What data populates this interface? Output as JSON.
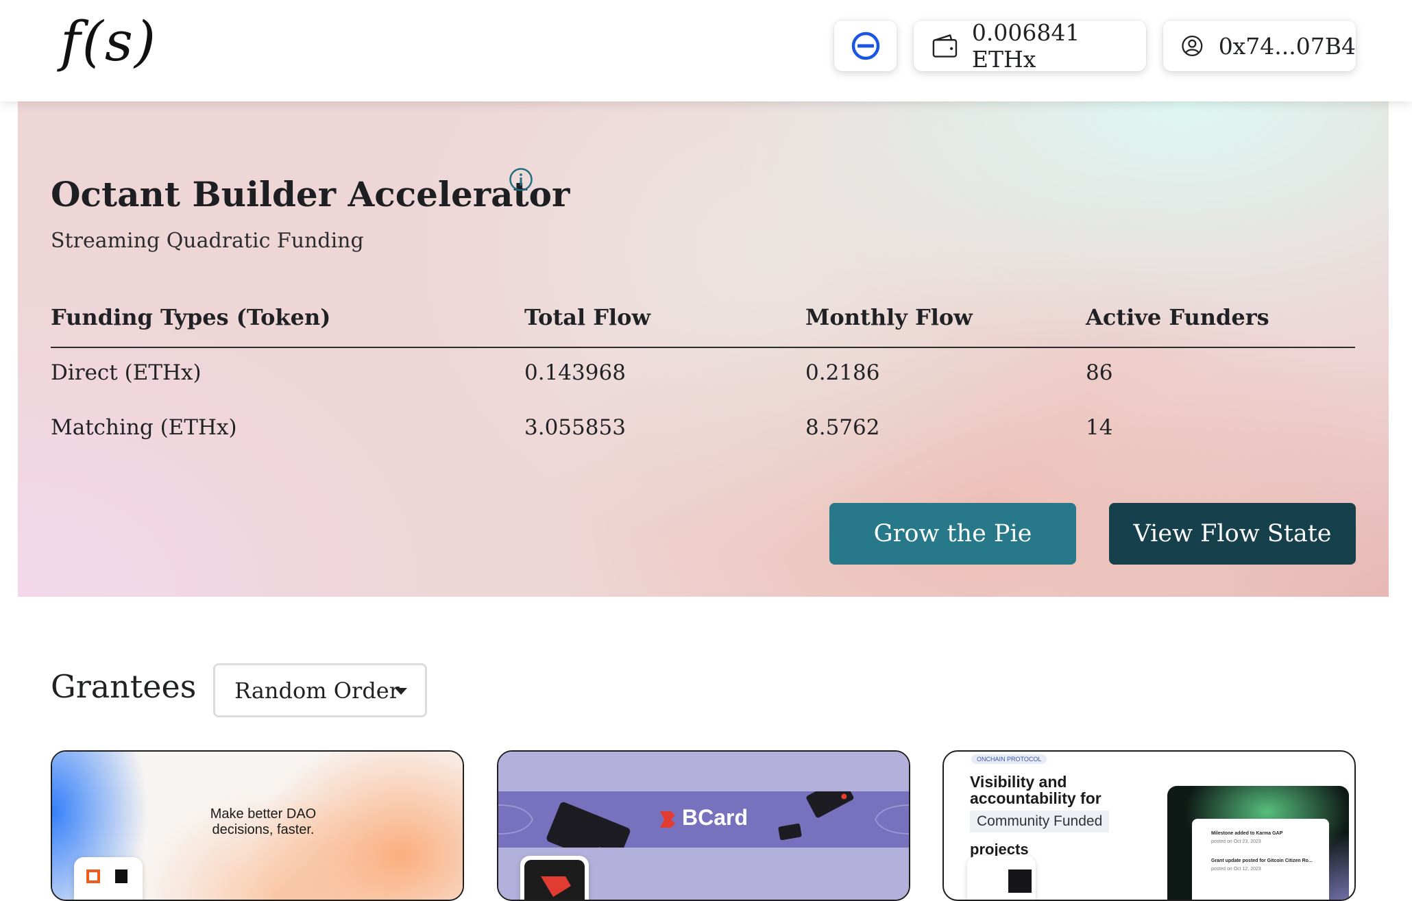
{
  "header": {
    "logo": "f(s)",
    "network_icon": "network-icon",
    "balance": "0.006841 ETHx",
    "account": "0x74...07B4"
  },
  "hero": {
    "title": "Octant Builder Accelerator",
    "subtitle": "Streaming Quadratic Funding",
    "table": {
      "headers": [
        "Funding Types (Token)",
        "Total Flow",
        "Monthly Flow",
        "Active Funders"
      ],
      "rows": [
        [
          "Direct (ETHx)",
          "0.143968",
          "0.2186",
          "86"
        ],
        [
          "Matching (ETHx)",
          "3.055853",
          "8.5762",
          "14"
        ]
      ]
    },
    "grow_button": "Grow the Pie",
    "view_button": "View Flow State"
  },
  "grantees": {
    "title": "Grantees",
    "sort_selected": "Random Order",
    "cards": [
      {
        "banner_text": "Make better DAO decisions, faster."
      },
      {
        "banner_text": "BCard"
      },
      {
        "badge": "ONCHAIN PROTOCOL",
        "heading": "Visibility and accountability for",
        "chip": "Community Funded",
        "heading_end": "projects",
        "feed_1": "Milestone added to Karma GAP",
        "feed_1_meta": "posted on Oct 23, 2023",
        "feed_2": "Grant update posted for Gitcoin Citizen Ro...",
        "feed_2_meta": "posted on Oct 12, 2023"
      }
    ]
  },
  "colors": {
    "grow_button": "#27798a",
    "view_button": "#16404b",
    "network_icon": "#1a55e3"
  }
}
